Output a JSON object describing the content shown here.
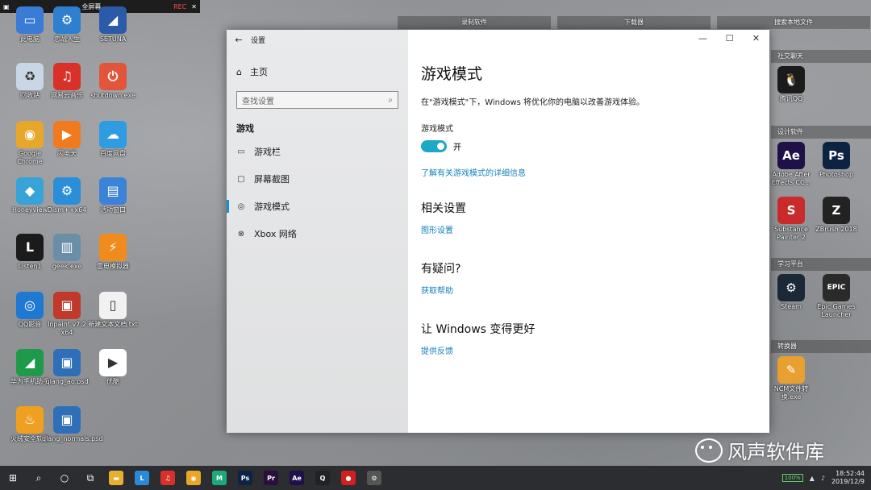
{
  "recorder": {
    "title": "全屏幕",
    "rec": "REC"
  },
  "desktop_left": [
    {
      "label": "此电脑",
      "icon": "computer-icon",
      "color": "#3a7bd5",
      "glyph": "▭"
    },
    {
      "label": "恋战人生",
      "icon": "gear-icon",
      "color": "#2f7fd0",
      "glyph": "⚙"
    },
    {
      "label": "SETUNA",
      "icon": "setuna-icon",
      "color": "#2a5aa8",
      "glyph": "◢"
    },
    {
      "label": "回收站",
      "icon": "recycle-bin-icon",
      "color": "#c9d6e6",
      "glyph": "♻"
    },
    {
      "label": "网易云音乐",
      "icon": "netease-music-icon",
      "color": "#d9302a",
      "glyph": "♫"
    },
    {
      "label": "shutdown.exe",
      "icon": "shutdown-icon",
      "color": "#e2553a",
      "glyph": "⏻"
    },
    {
      "label": "Google Chrome",
      "icon": "chrome-icon",
      "color": "#e6a72a",
      "glyph": "◉"
    },
    {
      "label": "闪电天",
      "icon": "video-icon",
      "color": "#f07a1e",
      "glyph": "▶"
    },
    {
      "label": "百度网盘",
      "icon": "baidu-netdisk-icon",
      "color": "#2f9be0",
      "glyph": "☁"
    },
    {
      "label": "Honeyview",
      "icon": "honeyview-icon",
      "color": "#38a3d6",
      "glyph": "◆"
    },
    {
      "label": "Dism++x64",
      "icon": "gears-icon",
      "color": "#2a8fd8",
      "glyph": "⚙"
    },
    {
      "label": "活动窗口",
      "icon": "window-icon",
      "color": "#3b83d6",
      "glyph": "▤"
    },
    {
      "label": "Listen1",
      "icon": "listen1-icon",
      "color": "#1b1b1b",
      "glyph": "L"
    },
    {
      "label": "geek.exe",
      "icon": "trash-can-icon",
      "color": "#6b8ea8",
      "glyph": "▥"
    },
    {
      "label": "雷电模拟器",
      "icon": "emulator-icon",
      "color": "#f08c1e",
      "glyph": "⚡"
    },
    {
      "label": "QQ影音",
      "icon": "qq-player-icon",
      "color": "#1f78d1",
      "glyph": "◎"
    },
    {
      "label": "Inpaint v7.2 x64",
      "icon": "inpaint-icon",
      "color": "#c0392b",
      "glyph": "▣"
    },
    {
      "label": "新建文本文档.txt",
      "icon": "text-file-icon",
      "color": "#f1f1f1",
      "glyph": "▯"
    },
    {
      "label": "华为手机助手",
      "icon": "huawei-icon",
      "color": "#1f9a4a",
      "glyph": "◢"
    },
    {
      "label": "qiang_ao.psd",
      "icon": "psd-file-icon",
      "color": "#2f6fb8",
      "glyph": "▣"
    },
    {
      "label": "优酷",
      "icon": "youku-icon",
      "color": "#ffffff",
      "glyph": "▶"
    },
    {
      "label": "火绒安全软件",
      "icon": "huorong-icon",
      "color": "#f0a020",
      "glyph": "♨"
    },
    {
      "label": "qiang_normals.psd",
      "icon": "psd-file-icon",
      "color": "#2f6fb8",
      "glyph": "▣"
    }
  ],
  "right_panel": {
    "top_groups": [
      "录制软件",
      "下载器",
      "搜索本地文件"
    ],
    "groups": [
      {
        "title": "社交聊天",
        "items": [
          {
            "label": "腾讯QQ",
            "icon": "qq-icon",
            "color": "#1b1b1b",
            "glyph": "🐧"
          }
        ]
      },
      {
        "title": "设计软件",
        "items": [
          {
            "label": "Adobe After Effects CC...",
            "icon": "after-effects-icon",
            "color": "#1f1047",
            "glyph": "Ae"
          },
          {
            "label": "Photoshop",
            "icon": "photoshop-icon",
            "color": "#0d2344",
            "glyph": "Ps"
          },
          {
            "label": "Substance Painter 2",
            "icon": "substance-icon",
            "color": "#c92a2a",
            "glyph": "S"
          },
          {
            "label": "ZBrush 2018",
            "icon": "zbrush-icon",
            "color": "#222222",
            "glyph": "Z"
          }
        ]
      },
      {
        "title": "学习平台",
        "items": [
          {
            "label": "Steam",
            "icon": "steam-icon",
            "color": "#1b2838",
            "glyph": "⚙"
          },
          {
            "label": "Epic Games Launcher",
            "icon": "epic-games-icon",
            "color": "#2a2a2a",
            "glyph": "EPIC"
          }
        ]
      },
      {
        "title": "转换器",
        "items": [
          {
            "label": "NCM文件转换.exe",
            "icon": "ncm-convert-icon",
            "color": "#e8a030",
            "glyph": "✎"
          }
        ]
      }
    ]
  },
  "settings": {
    "window_title": "设置",
    "home": "主页",
    "search_placeholder": "查找设置",
    "section": "游戏",
    "nav": [
      "游戏栏",
      "屏幕截图",
      "游戏模式",
      "Xbox 网络"
    ],
    "active_nav": 2,
    "page_title": "游戏模式",
    "description": "在\"游戏模式\"下，Windows 将优化你的电脑以改善游戏体验。",
    "toggle_label": "游戏模式",
    "toggle_state": "开",
    "learn_more": "了解有关游戏模式的详细信息",
    "related_title": "相关设置",
    "related_link": "图形设置",
    "question_title": "有疑问?",
    "help_link": "获取帮助",
    "improve_title": "让 Windows 变得更好",
    "feedback_link": "提供反馈",
    "accent_color": "#1ca8c7"
  },
  "taskbar": {
    "apps": [
      {
        "icon": "file-explorer-icon",
        "color": "#e8b030",
        "glyph": "▬"
      },
      {
        "icon": "clock-app-icon",
        "color": "#2a8ad8",
        "glyph": "L"
      },
      {
        "icon": "netease-music-icon",
        "color": "#d9302a",
        "glyph": "♫"
      },
      {
        "icon": "chrome-icon",
        "color": "#e6a72a",
        "glyph": "◉"
      },
      {
        "icon": "m-app-icon",
        "color": "#1fa87a",
        "glyph": "M"
      },
      {
        "icon": "photoshop-icon",
        "color": "#0d2344",
        "glyph": "Ps"
      },
      {
        "icon": "premiere-icon",
        "color": "#2a0f3d",
        "glyph": "Pr"
      },
      {
        "icon": "after-effects-icon",
        "color": "#1f1047",
        "glyph": "Ae"
      },
      {
        "icon": "qq-icon",
        "color": "#222222",
        "glyph": "Q"
      },
      {
        "icon": "record-icon",
        "color": "#d02020",
        "glyph": "●"
      },
      {
        "icon": "settings-icon",
        "color": "#555555",
        "glyph": "⚙"
      }
    ],
    "battery": "100%",
    "time": "18:52:44",
    "date": "2019/12/9"
  },
  "watermark": "风声软件库"
}
